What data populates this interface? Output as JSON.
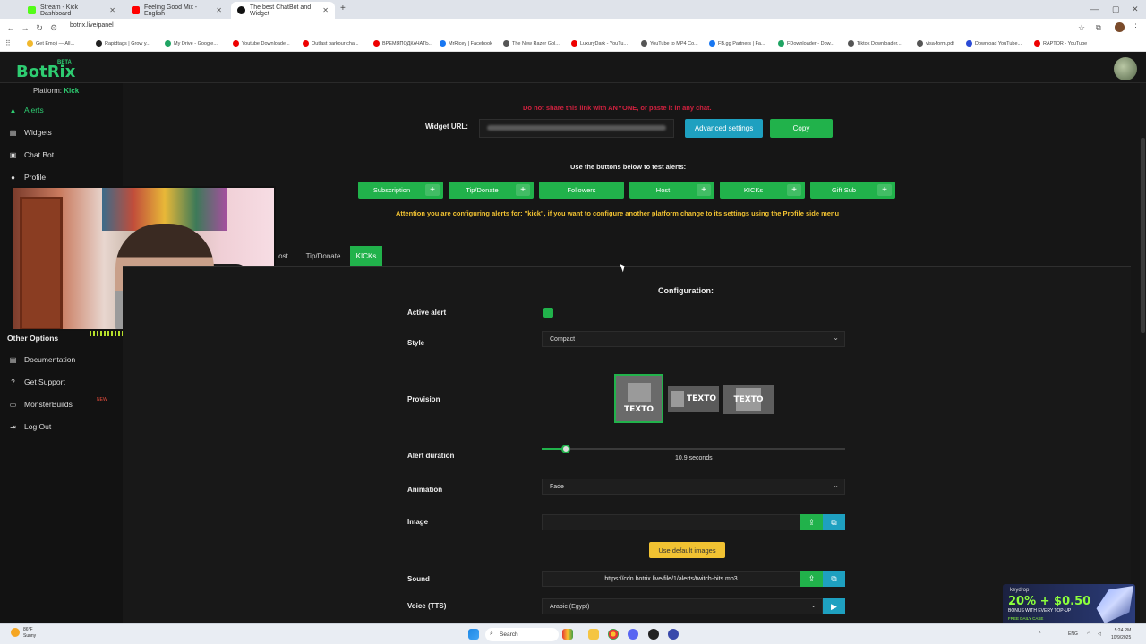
{
  "browser": {
    "tabs": [
      {
        "title": "Stream - Kick Dashboard",
        "color": "#53fc18"
      },
      {
        "title": "Feeling Good Mix - English",
        "color": "#ff0000"
      },
      {
        "title": "The best ChatBot and Widget",
        "color": "#111111"
      }
    ],
    "new_tab": "+",
    "url": "botrix.live/panel",
    "bookmarks": [
      "Get Emoji — All...",
      "Rapidtags | Grow y...",
      "My Drive - Google...",
      "Youtube Downloade...",
      "Outlast parkour cha...",
      "ВРЕМЯПОДКАЧАТЬ...",
      "MrRicey | Facebook",
      "The New Razer Gol...",
      "LuxuryDark - YouTu...",
      "YouTube to MP4 Co...",
      "FB.gg Partners | Fa...",
      "FDownloader - Dow...",
      "Tiktok Downloader...",
      "visa-form.pdf",
      "Download YouTube...",
      "RAPTOR - YouTube"
    ]
  },
  "app": {
    "logo": "BotRix",
    "beta": "BETA",
    "platform_label": "Platform:",
    "platform_value": "Kick",
    "sidebar": [
      {
        "label": "Alerts",
        "icon": "warning-icon"
      },
      {
        "label": "Widgets",
        "icon": "widgets-icon"
      },
      {
        "label": "Chat Bot",
        "icon": "robot-icon"
      },
      {
        "label": "Profile",
        "icon": "user-icon"
      }
    ],
    "other_options_title": "Other Options",
    "other_options": [
      {
        "label": "Documentation",
        "icon": "book-icon"
      },
      {
        "label": "Get Support",
        "icon": "question-icon"
      },
      {
        "label": "MonsterBuilds",
        "icon": "monitor-icon"
      },
      {
        "label": "Log Out",
        "icon": "logout-icon"
      }
    ],
    "new_badge": "NEW"
  },
  "main": {
    "warning": "Do not share this link with ANYONE, or paste it in any chat.",
    "widget_url_label": "Widget URL:",
    "widget_url_value": "https://botrix.live/alerts?bid=••••••••••••",
    "advanced_settings": "Advanced settings",
    "copy": "Copy",
    "test_label": "Use the buttons below to test alerts:",
    "test_buttons": [
      {
        "label": "Subscription",
        "plus": true
      },
      {
        "label": "Tip/Donate",
        "plus": true
      },
      {
        "label": "Followers",
        "plus": false
      },
      {
        "label": "Host",
        "plus": true
      },
      {
        "label": "KICKs",
        "plus": true
      },
      {
        "label": "Gift Sub",
        "plus": true
      }
    ],
    "attention": "Attention you are configuring alerts for: \"kick\", if you want to configure another platform change to its settings using the Profile side menu",
    "tabs": [
      "ost",
      "Tip/Donate",
      "KICKs"
    ],
    "config_title": "Configuration:",
    "active_alert_label": "Active alert",
    "active_alert_checked": true,
    "style_label": "Style",
    "style_value": "Compact",
    "provision_label": "Provision",
    "provision_text": "TEXTO",
    "alert_duration_label": "Alert duration",
    "alert_duration_value": "10.9 seconds",
    "alert_duration_fraction": 0.08,
    "animation_label": "Animation",
    "animation_value": "Fade",
    "image_label": "Image",
    "image_value": "",
    "use_default_images": "Use default images",
    "sound_label": "Sound",
    "sound_value": "https://cdn.botrix.live/file/1/alerts/twitch-bits.mp3",
    "voice_label": "Voice (TTS)",
    "voice_value": "Arabic (Egypt)"
  },
  "ad": {
    "brand": "keydrop",
    "headline": "20% + $0.50",
    "sub": "BONUS WITH EVERY TOP-UP",
    "tag": "FREE DAILY CASE"
  },
  "taskbar": {
    "weather_temp": "86°F",
    "weather_desc": "Sunny",
    "search": "Search",
    "lang": "ENG",
    "time": "5:24 PM",
    "date": "10/9/2025"
  },
  "colors": {
    "accent": "#21b24b",
    "blue": "#1ea0c0",
    "warning": "#f1c232",
    "danger": "#d0213f"
  }
}
